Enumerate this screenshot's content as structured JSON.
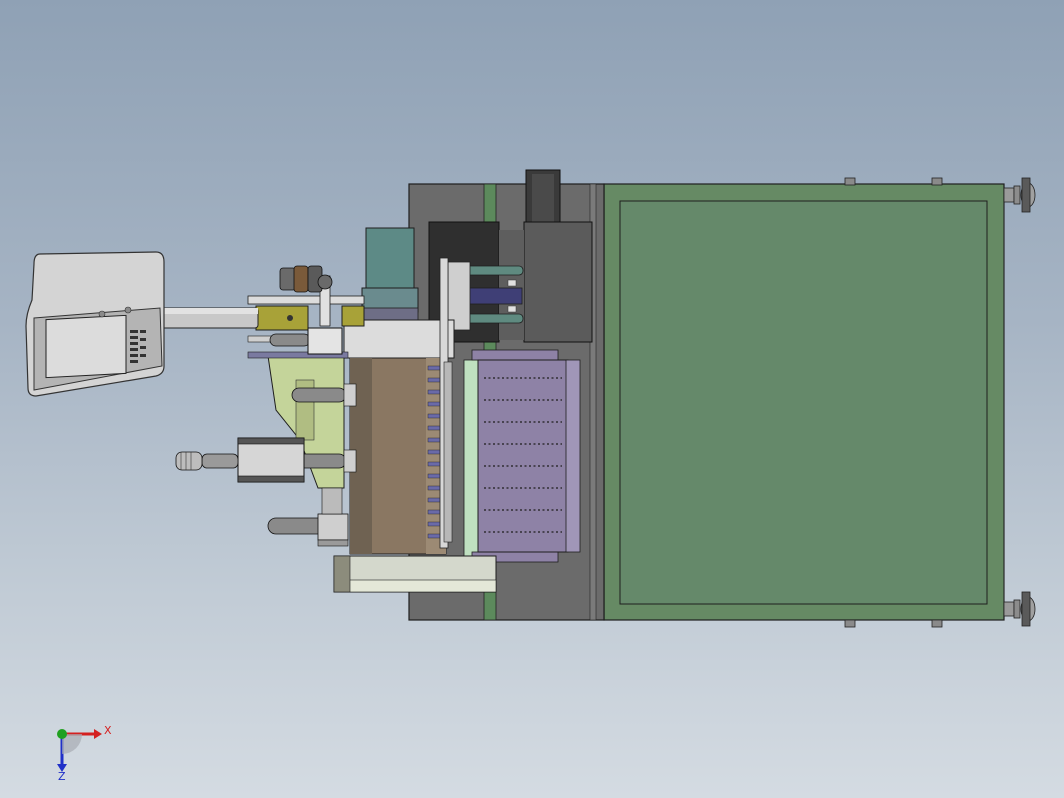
{
  "viewport": {
    "background_top": "#8fa1b5",
    "background_bottom": "#d4dbe2"
  },
  "model": {
    "view": "top",
    "colors": {
      "frame_green": "#668a64",
      "base_gray": "#6b6b6b",
      "tray_purple": "#8e82a6",
      "cylinder_brown": "#8a7762",
      "motor_teal": "#5d8a86",
      "bracket_olive": "#a8a238",
      "plate_light": "#d4d8cc",
      "panel_light_green": "#c4d49a"
    },
    "components": [
      "control-panel",
      "panel-support-arm",
      "servo-motor",
      "pneumatic-cylinders",
      "rotary-drum",
      "feed-tray",
      "motor-column",
      "base-plate",
      "main-frame",
      "leveling-feet"
    ]
  },
  "triad": {
    "x_label": "X",
    "z_label": "Z",
    "x_color": "#d42020",
    "z_color": "#2030c8",
    "origin_color": "#20a020"
  }
}
